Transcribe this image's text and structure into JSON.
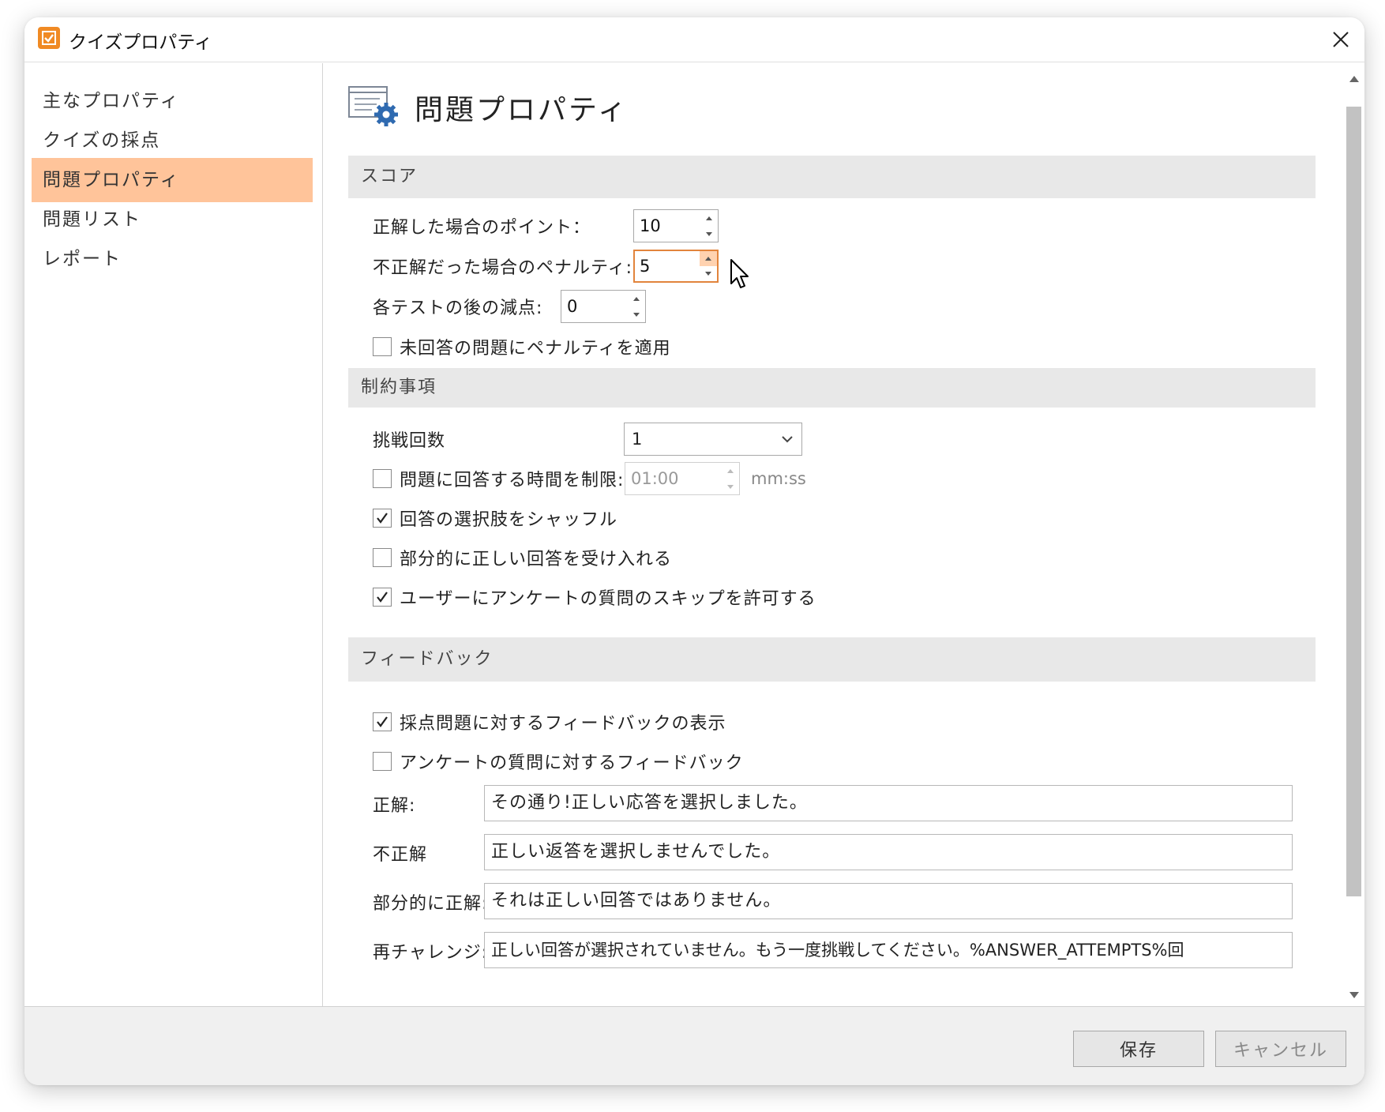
{
  "window": {
    "title": "クイズプロパティ",
    "accent": "#f08a24"
  },
  "sidebar": {
    "items": [
      {
        "label": "主なプロパティ"
      },
      {
        "label": "クイズの採点"
      },
      {
        "label": "問題プロパティ",
        "active": true
      },
      {
        "label": "問題リスト"
      },
      {
        "label": "レポート"
      }
    ],
    "active_color": "#ffc49a"
  },
  "page": {
    "title": "問題プロパティ",
    "icon": "question-properties-icon"
  },
  "score": {
    "header": "スコア",
    "correct_points_label": "正解した場合のポイント：",
    "correct_points_value": "10",
    "penalty_label": "不正解だった場合のペナルティ:",
    "penalty_value": "5",
    "deduction_label": "各テストの後の減点:",
    "deduction_value": "0",
    "apply_penalty_label": "未回答の問題にペナルティを適用"
  },
  "restrictions": {
    "header": "制約事項",
    "attempts_label": "挑戦回数",
    "attempts_value": "1",
    "limit_time_label": "問題に回答する時間を制限:",
    "time_value": "01:00",
    "time_unit": "mm:ss",
    "shuffle_label": "回答の選択肢をシャッフル",
    "partial_label": "部分的に正しい回答を受け入れる",
    "skip_label": "ユーザーにアンケートの質問のスキップを許可する"
  },
  "feedback": {
    "header": "フィードバック",
    "show_graded_label": "採点問題に対するフィードバックの表示",
    "survey_label": "アンケートの質問に対するフィードバック",
    "correct_label": "正解:",
    "correct_value": "その通り!正しい応答を選択しました。",
    "incorrect_label": "不正解",
    "incorrect_value": "正しい返答を選択しませんでした。",
    "partial_label": "部分的に正解:",
    "partial_value": "それは正しい回答ではありません。",
    "retry_label": "再チャレンジ:",
    "retry_value": "正しい回答が選択されていません。もう一度挑戦してください。%ANSWER_ATTEMPTS%回"
  },
  "checkboxes": {
    "apply_penalty": false,
    "limit_time": false,
    "shuffle": true,
    "partial": false,
    "skip": true,
    "show_graded": true,
    "survey": false
  },
  "footer": {
    "save": "保存",
    "cancel": "キャンセル"
  }
}
